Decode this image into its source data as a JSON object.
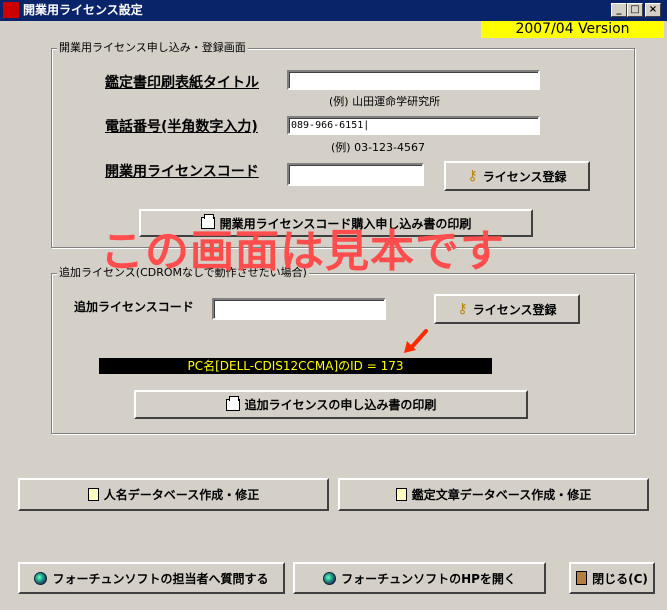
{
  "window": {
    "title": "開業用ライセンス設定",
    "icon_text": "",
    "version": "2007/04 Version",
    "controls": {
      "minimize": "_",
      "maximize": "□",
      "close": "×"
    }
  },
  "group1": {
    "label": "開業用ライセンス申し込み・登録画面",
    "title_field": {
      "label": "鑑定書印刷表紙タイトル",
      "value": "",
      "example": "(例) 山田運命学研究所"
    },
    "phone_field": {
      "label": "電話番号(半角数字入力)",
      "value": "089-966-6151|",
      "example": "(例) 03-123-4567"
    },
    "license_code": {
      "label": "開業用ライセンスコード",
      "value": ""
    },
    "register_button": "ライセンス登録",
    "print_button": "開業用ライセンスコード購入申し込み書の印刷"
  },
  "overlay_notice": "この画面は見本です",
  "group2": {
    "label": "追加ライセンス(CDROMなしで動作させたい場合)",
    "code_field": {
      "label": "追加ライセンスコード",
      "value": ""
    },
    "register_button": "ライセンス登録",
    "pc_info": "PC名[DELL-CDIS12CCMA]のID = 173",
    "print_button": "追加ライセンスの申し込み書の印刷"
  },
  "buttons": {
    "name_db": "人名データベース作成・修正",
    "text_db": "鑑定文章データベース作成・修正",
    "contact": "フォーチュンソフトの担当者へ質問する",
    "homepage": "フォーチュンソフトのHPを開く",
    "close": "閉じる(C)"
  },
  "colors": {
    "titlebar": "#0a246a",
    "version_bg": "#ffff00",
    "notice": "#ff4d4d",
    "pc_bar_bg": "#000000",
    "pc_bar_text": "#ffff00"
  }
}
